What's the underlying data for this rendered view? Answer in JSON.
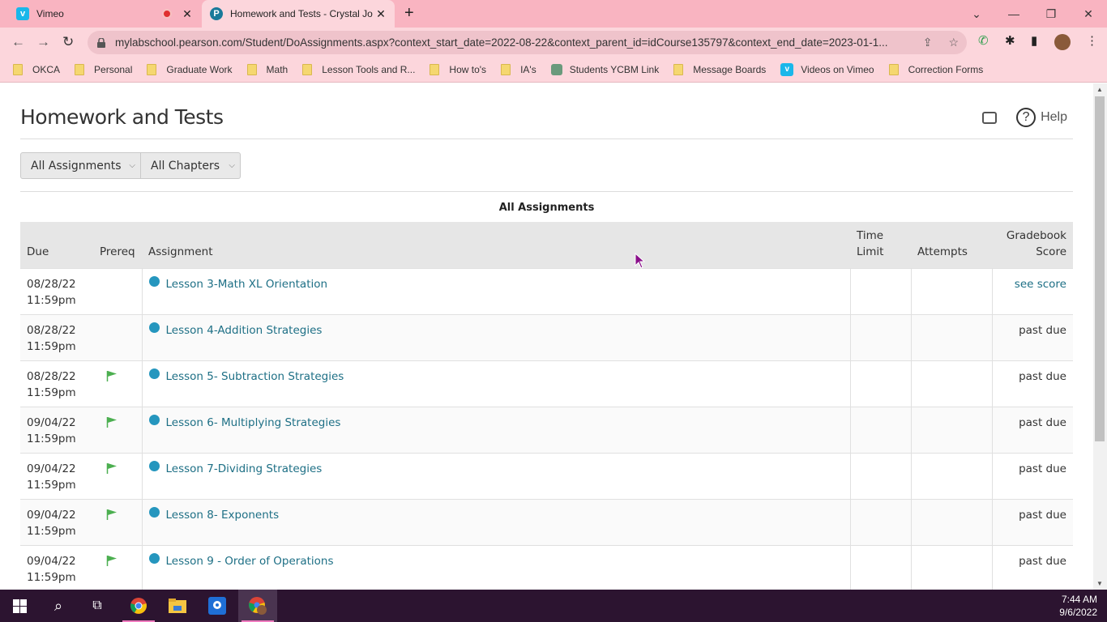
{
  "browser": {
    "tabs": [
      {
        "title": "Vimeo",
        "favicon": "vimeo-icon",
        "recording": true,
        "active": false
      },
      {
        "title": "Homework and Tests - Crystal Jo",
        "favicon": "pearson-icon",
        "active": true
      }
    ],
    "new_tab_label": "+",
    "url": "mylabschool.pearson.com/Student/DoAssignments.aspx?context_start_date=2022-08-22&context_parent_id=idCourse135797&context_end_date=2023-01-1...",
    "bookmarks": [
      {
        "label": "OKCA",
        "icon": "folder-icon"
      },
      {
        "label": "Personal",
        "icon": "folder-icon"
      },
      {
        "label": "Graduate Work",
        "icon": "folder-icon"
      },
      {
        "label": "Math",
        "icon": "folder-icon"
      },
      {
        "label": "Lesson Tools and R...",
        "icon": "folder-icon"
      },
      {
        "label": "How to's",
        "icon": "folder-icon"
      },
      {
        "label": "IA's",
        "icon": "folder-icon"
      },
      {
        "label": "Students YCBM Link",
        "icon": "ycbm-icon"
      },
      {
        "label": "Message Boards",
        "icon": "folder-icon"
      },
      {
        "label": "Videos on Vimeo",
        "icon": "vimeo-icon"
      },
      {
        "label": "Correction Forms",
        "icon": "folder-icon"
      }
    ]
  },
  "page": {
    "title": "Homework and Tests",
    "help_label": "Help",
    "filters": {
      "assignments": "All Assignments",
      "chapters": "All Chapters"
    },
    "caption": "All Assignments",
    "table": {
      "headers": {
        "due": "Due",
        "prereq": "Prereq",
        "assignment": "Assignment",
        "time_limit_1": "Time",
        "time_limit_2": "Limit",
        "attempts": "Attempts",
        "score_1": "Gradebook",
        "score_2": "Score"
      },
      "rows": [
        {
          "date": "08/28/22",
          "time": "11:59pm",
          "prereq": false,
          "assignment": "Lesson 3-Math XL Orientation",
          "time_limit": "",
          "attempts": "",
          "score": "see score",
          "score_link": true
        },
        {
          "date": "08/28/22",
          "time": "11:59pm",
          "prereq": false,
          "assignment": "Lesson 4-Addition Strategies",
          "time_limit": "",
          "attempts": "",
          "score": "past due",
          "score_link": false
        },
        {
          "date": "08/28/22",
          "time": "11:59pm",
          "prereq": true,
          "assignment": "Lesson 5- Subtraction Strategies",
          "time_limit": "",
          "attempts": "",
          "score": "past due",
          "score_link": false
        },
        {
          "date": "09/04/22",
          "time": "11:59pm",
          "prereq": true,
          "assignment": "Lesson 6- Multiplying Strategies",
          "time_limit": "",
          "attempts": "",
          "score": "past due",
          "score_link": false
        },
        {
          "date": "09/04/22",
          "time": "11:59pm",
          "prereq": true,
          "assignment": "Lesson 7-Dividing Strategies",
          "time_limit": "",
          "attempts": "",
          "score": "past due",
          "score_link": false
        },
        {
          "date": "09/04/22",
          "time": "11:59pm",
          "prereq": true,
          "assignment": "Lesson 8- Exponents",
          "time_limit": "",
          "attempts": "",
          "score": "past due",
          "score_link": false
        },
        {
          "date": "09/04/22",
          "time": "11:59pm",
          "prereq": true,
          "assignment": "Lesson 9 - Order of Operations",
          "time_limit": "",
          "attempts": "",
          "score": "past due",
          "score_link": false
        }
      ]
    }
  },
  "taskbar": {
    "apps": [
      "windows-start-icon",
      "search-icon",
      "task-view-icon",
      "chrome-icon",
      "file-explorer-icon",
      "maps-icon",
      "chrome-profile-icon"
    ],
    "time": "7:44 AM",
    "date": "9/6/2022"
  },
  "colors": {
    "tabbar": "#f9b4c1",
    "toolbar": "#fcd6dc",
    "link": "#1d6f85",
    "status_dot": "#2596be",
    "flag": "#4caf50",
    "taskbar": "#2c1430",
    "cursor": "#8a0f8a"
  }
}
